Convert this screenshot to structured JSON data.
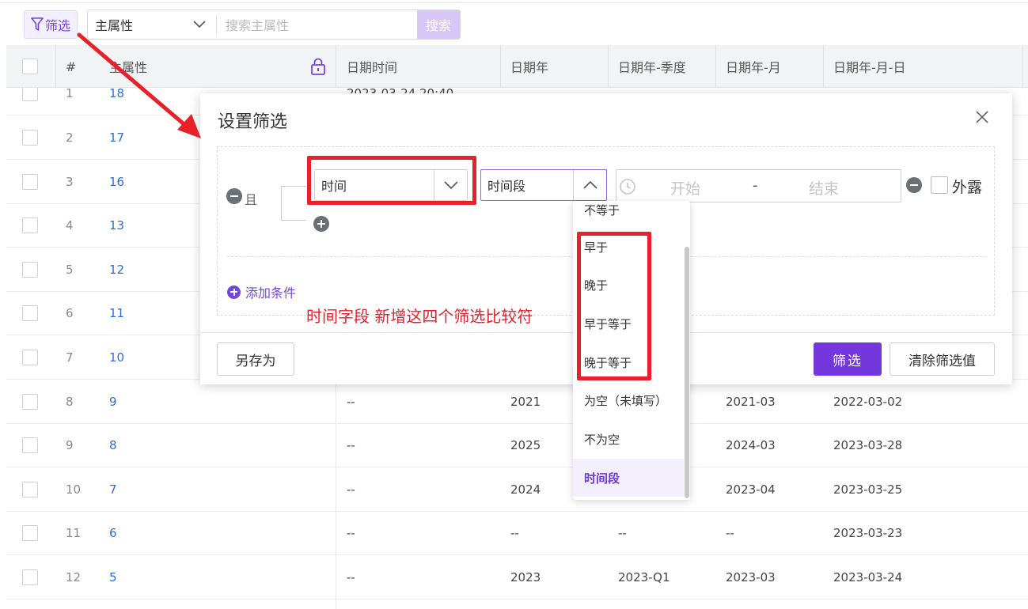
{
  "toolbar": {
    "filter_label": "筛选",
    "search_select": "主属性",
    "search_placeholder": "搜索主属性",
    "search_button": "搜索"
  },
  "table": {
    "headers": [
      "#",
      "主属性",
      "日期时间",
      "日期年",
      "日期年-季度",
      "日期年-月",
      "日期年-月-日"
    ],
    "partial_first_row_datetime": "2023-03-24 20:40",
    "rows": [
      {
        "idx": "1",
        "main": "18",
        "datetime": "",
        "year": "",
        "quarter": "",
        "month": "",
        "day": ""
      },
      {
        "idx": "2",
        "main": "17",
        "datetime": "",
        "year": "",
        "quarter": "",
        "month": "",
        "day": ""
      },
      {
        "idx": "3",
        "main": "16",
        "datetime": "",
        "year": "",
        "quarter": "",
        "month": "",
        "day": ""
      },
      {
        "idx": "4",
        "main": "13",
        "datetime": "",
        "year": "",
        "quarter": "",
        "month": "",
        "day": ""
      },
      {
        "idx": "5",
        "main": "12",
        "datetime": "",
        "year": "",
        "quarter": "",
        "month": "",
        "day": ""
      },
      {
        "idx": "6",
        "main": "11",
        "datetime": "",
        "year": "",
        "quarter": "",
        "month": "",
        "day": ""
      },
      {
        "idx": "7",
        "main": "10",
        "datetime": "",
        "year": "",
        "quarter": "",
        "month": "",
        "day": ""
      },
      {
        "idx": "8",
        "main": "9",
        "datetime": "--",
        "year": "2021",
        "quarter": "",
        "month": "2021-03",
        "day": "2022-03-02"
      },
      {
        "idx": "9",
        "main": "8",
        "datetime": "--",
        "year": "2025",
        "quarter": "",
        "month": "2024-03",
        "day": "2023-03-28"
      },
      {
        "idx": "10",
        "main": "7",
        "datetime": "--",
        "year": "2024",
        "quarter": "",
        "month": "2023-04",
        "day": "2023-03-25"
      },
      {
        "idx": "11",
        "main": "6",
        "datetime": "--",
        "year": "--",
        "quarter": "--",
        "month": "--",
        "day": "2023-03-23"
      },
      {
        "idx": "12",
        "main": "5",
        "datetime": "--",
        "year": "2023",
        "quarter": "2023-Q1",
        "month": "2023-03",
        "day": "2023-03-24"
      }
    ]
  },
  "dialog": {
    "title": "设置筛选",
    "and_label": "且",
    "field_value": "时间",
    "operator_value": "时间段",
    "range_start": "开始",
    "range_dash": "-",
    "range_end": "结束",
    "expose_label": "外露",
    "add_condition": "添加条件",
    "save_as": "另存为",
    "filter_button": "筛选",
    "clear_button": "清除筛选值"
  },
  "dropdown": {
    "items": [
      "不等于",
      "早于",
      "晚于",
      "早于等于",
      "晚于等于",
      "为空（未填写）",
      "不为空",
      "时间段"
    ],
    "selected": "时间段"
  },
  "annotation": {
    "text": "时间字段 新增这四个筛选比较符"
  },
  "colors": {
    "accent": "#7337dc",
    "annotation_red": "#e8202a",
    "link_blue": "#2f6cd6"
  }
}
